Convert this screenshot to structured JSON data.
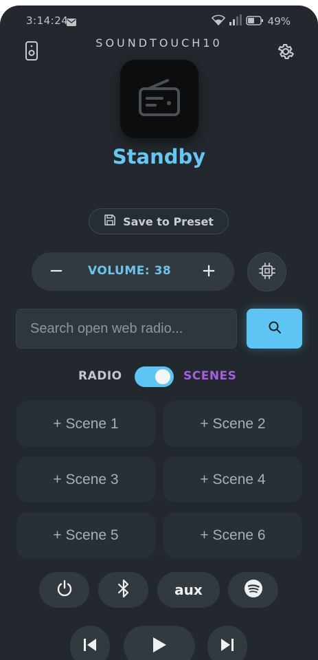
{
  "status_bar": {
    "time": "3:14:24",
    "battery": "49%"
  },
  "header": {
    "title": "SOUNDTOUCH10"
  },
  "player": {
    "state": "Standby"
  },
  "preset": {
    "save_label": "Save to Preset"
  },
  "volume": {
    "minus": "−",
    "label": "VOLUME: 38",
    "plus": "+",
    "level": 38
  },
  "search": {
    "placeholder": "Search open web radio..."
  },
  "mode": {
    "left_label": "RADIO",
    "right_label": "SCENES",
    "selected": "SCENES"
  },
  "scenes": [
    "+ Scene 1",
    "+ Scene 2",
    "+ Scene 3",
    "+ Scene 4",
    "+ Scene 5",
    "+ Scene 6"
  ],
  "controls": {
    "aux_label": "aux"
  },
  "icons": [
    "speaker-icon",
    "gear-icon",
    "radio-icon",
    "save-icon",
    "chip-icon",
    "search-icon",
    "power-icon",
    "bluetooth-icon",
    "spotify-icon",
    "skip-previous-icon",
    "play-icon",
    "skip-next-icon",
    "wifi-icon",
    "signal-icon",
    "battery-icon",
    "mail-icon"
  ],
  "colors": {
    "accent": "#5ec4f4",
    "status": "#67c6f2",
    "scenes": "#a55fe0",
    "background": "#22282d"
  }
}
